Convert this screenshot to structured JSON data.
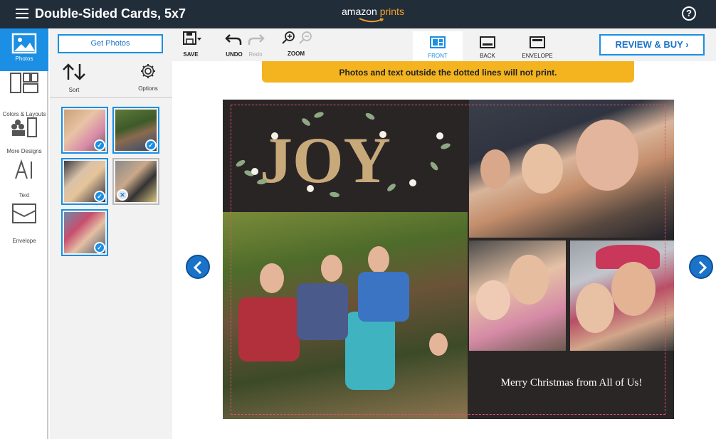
{
  "app": {
    "title": "Double-Sided Cards, 5x7",
    "logo_main": "amazon",
    "logo_accent": "prints",
    "help_label": "?"
  },
  "rail": {
    "items": [
      {
        "label": "Photos",
        "icon": "photos-icon"
      },
      {
        "label": "Colors & Layouts",
        "icon": "layouts-icon"
      },
      {
        "label": "More Designs",
        "icon": "designs-icon"
      },
      {
        "label": "Text",
        "icon": "text-icon"
      },
      {
        "label": "Envelope",
        "icon": "envelope-icon"
      }
    ]
  },
  "panel": {
    "get_photos": "Get Photos",
    "sort_label": "Sort",
    "options_label": "Options"
  },
  "toolbar": {
    "save": "SAVE",
    "undo": "UNDO",
    "redo": "Redo",
    "zoom": "ZOOM",
    "tabs": [
      "FRONT",
      "BACK",
      "ENVELOPE"
    ],
    "review_buy": "REVIEW & BUY"
  },
  "warning": "Photos and text outside the dotted lines will not print.",
  "card": {
    "headline": "JOY",
    "greeting": "Merry Christmas from All of Us!"
  },
  "colors": {
    "accent": "#1a8fe3",
    "topbar": "#222d3a",
    "warning": "#f4b41f",
    "card": "#2a2626"
  }
}
